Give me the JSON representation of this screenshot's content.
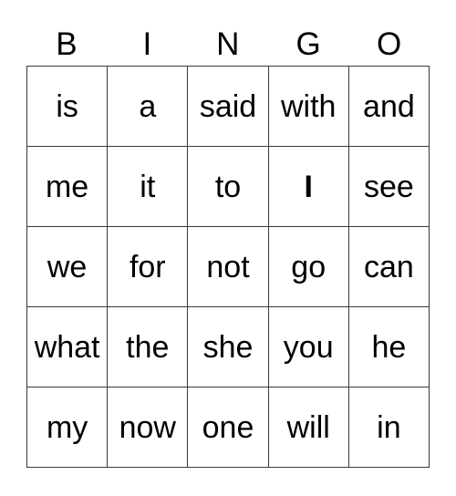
{
  "card": {
    "title": "BINGO",
    "headers": [
      "B",
      "I",
      "N",
      "G",
      "O"
    ],
    "colors": {
      "background": "#ffffff",
      "border": "#3a3a3a",
      "text": "#000000"
    },
    "rows": [
      [
        {
          "label": "is",
          "bold": false
        },
        {
          "label": "a",
          "bold": false
        },
        {
          "label": "said",
          "bold": false
        },
        {
          "label": "with",
          "bold": false
        },
        {
          "label": "and",
          "bold": false
        }
      ],
      [
        {
          "label": "me",
          "bold": false
        },
        {
          "label": "it",
          "bold": false
        },
        {
          "label": "to",
          "bold": false
        },
        {
          "label": "I",
          "bold": true
        },
        {
          "label": "see",
          "bold": false
        }
      ],
      [
        {
          "label": "we",
          "bold": false
        },
        {
          "label": "for",
          "bold": false
        },
        {
          "label": "not",
          "bold": false
        },
        {
          "label": "go",
          "bold": false
        },
        {
          "label": "can",
          "bold": false
        }
      ],
      [
        {
          "label": "what",
          "bold": false
        },
        {
          "label": "the",
          "bold": false
        },
        {
          "label": "she",
          "bold": false
        },
        {
          "label": "you",
          "bold": false
        },
        {
          "label": "he",
          "bold": false
        }
      ],
      [
        {
          "label": "my",
          "bold": false
        },
        {
          "label": "now",
          "bold": false
        },
        {
          "label": "one",
          "bold": false
        },
        {
          "label": "will",
          "bold": false
        },
        {
          "label": "in",
          "bold": false
        }
      ]
    ]
  }
}
